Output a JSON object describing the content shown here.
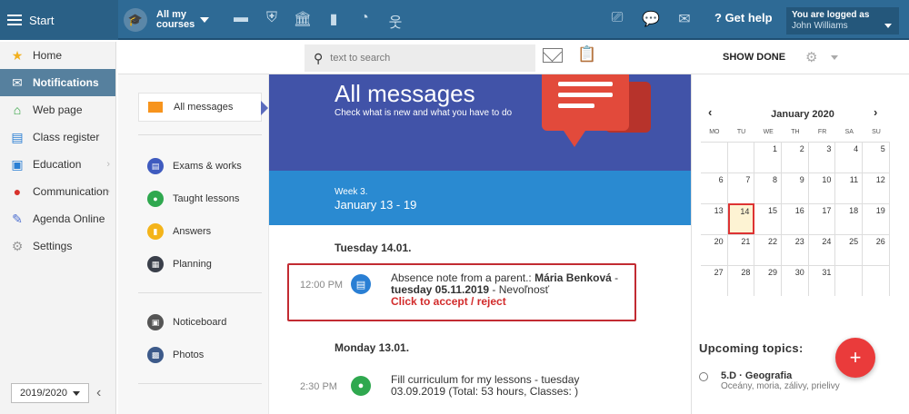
{
  "topbar": {
    "start_label": "Start",
    "courses_label": "All my courses",
    "help_label": "Get help",
    "logged_as": "You are logged as",
    "user_name": "John Williams"
  },
  "sidebar": {
    "items": [
      {
        "label": "Home",
        "icon": "star-icon"
      },
      {
        "label": "Notifications",
        "icon": "envelope-icon"
      },
      {
        "label": "Web page",
        "icon": "house-icon"
      },
      {
        "label": "Class register",
        "icon": "book-icon"
      },
      {
        "label": "Education",
        "icon": "education-icon"
      },
      {
        "label": "Communication",
        "icon": "chat-icon"
      },
      {
        "label": "Agenda Online",
        "icon": "pen-icon"
      },
      {
        "label": "Settings",
        "icon": "gear-icon"
      }
    ],
    "year": "2019/2020"
  },
  "search": {
    "placeholder": "text to search",
    "show_done": "SHOW DONE"
  },
  "categories": {
    "all": "All messages",
    "items": [
      "Exams & works",
      "Taught lessons",
      "Answers",
      "Planning",
      "Noticeboard",
      "Photos"
    ]
  },
  "feed": {
    "title": "All messages",
    "subtitle": "Check what is new and what you have to do",
    "week_label": "Week 3.",
    "week_range": "January 13 - 19",
    "days": [
      {
        "header": "Tuesday 14.01.",
        "message": {
          "time": "12:00 PM",
          "text_prefix": "Absence note from a parent.: ",
          "name": "Mária Benková",
          "sep": " - ",
          "date": "tuesday 05.11.2019",
          "text_suffix": " - Nevoľnosť",
          "action": "Click to accept / reject"
        }
      },
      {
        "header": "Monday 13.01.",
        "message": {
          "time": "2:30 PM",
          "text": "Fill curriculum for my lessons - tuesday 03.09.2019 (Total: 53 hours, Classes: )"
        }
      }
    ]
  },
  "calendar": {
    "title": "January 2020",
    "prev": "‹",
    "next": "›",
    "dows": [
      "MO",
      "TU",
      "WE",
      "TH",
      "FR",
      "SA",
      "SU"
    ],
    "today": 14,
    "cells": [
      "",
      "",
      "1",
      "2",
      "3",
      "4",
      "5",
      "6",
      "7",
      "8",
      "9",
      "10",
      "11",
      "12",
      "13",
      "14",
      "15",
      "16",
      "17",
      "18",
      "19",
      "20",
      "21",
      "22",
      "23",
      "24",
      "25",
      "26",
      "27",
      "28",
      "29",
      "30",
      "31",
      "",
      ""
    ]
  },
  "upcoming": {
    "title": "Upcoming topics:",
    "item_title": "5.D · Geografia",
    "item_sub": "Oceány, moria, zálivy, prielivy"
  }
}
